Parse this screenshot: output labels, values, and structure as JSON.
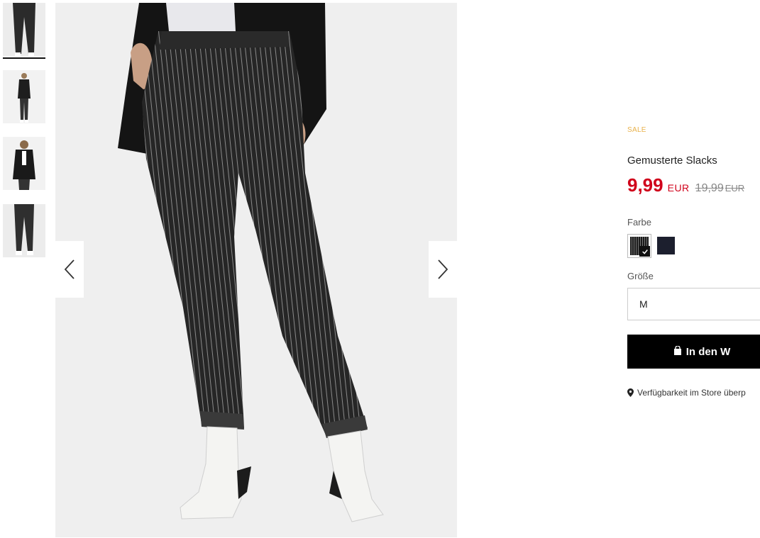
{
  "gallery": {
    "prev_arrow": "chevron-left-icon",
    "next_arrow": "chevron-right-icon",
    "thumbnails": [
      "thumbnail-1",
      "thumbnail-2",
      "thumbnail-3",
      "thumbnail-4"
    ]
  },
  "product": {
    "badge": "SALE",
    "title": "Gemusterte Slacks",
    "price": "9,99",
    "currency": "EUR",
    "old_price": "19,99",
    "old_currency": "EUR"
  },
  "color": {
    "label": "Farbe",
    "options": [
      "pinstripe",
      "navy"
    ],
    "selected": "pinstripe"
  },
  "size": {
    "label": "Größe",
    "selected": "M"
  },
  "cart": {
    "button_label": "In den W"
  },
  "store": {
    "link_label": "Verfügbarkeit im Store überp"
  },
  "colors": {
    "sale": "#e8b14a",
    "price": "#d0021b",
    "button": "#000000"
  }
}
